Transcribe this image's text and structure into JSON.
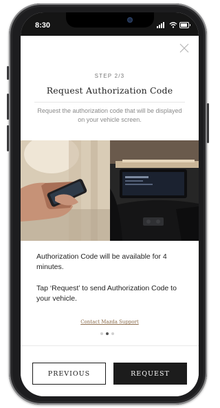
{
  "status_bar": {
    "time": "8:30",
    "icons": [
      "signal-icon",
      "wifi-icon",
      "battery-icon"
    ]
  },
  "dialog": {
    "close_icon": "close-icon",
    "step_label": "STEP 2/3",
    "title": "Request Authorization Code",
    "subtitle": "Request the authorization code that will be displayed on your vehicle screen.",
    "images": [
      "hand-holding-phone-photo",
      "vehicle-dashboard-screen-photo"
    ],
    "body_paragraph_1": "Authorization Code will be available for 4 minutes.",
    "body_paragraph_2": "Tap ‘Request’ to send Authorization Code to your vehicle.",
    "support_link": "Contact Mazda Support",
    "pagination": {
      "total": 3,
      "active": 2
    }
  },
  "footer": {
    "previous_label": "PREVIOUS",
    "request_label": "REQUEST"
  },
  "colors": {
    "primary_dark": "#1c1c1c",
    "link_color": "#8a6a4a",
    "muted_text": "#8a8a8a",
    "dot_active": "#555555",
    "dot_inactive": "#d0d0d0"
  }
}
